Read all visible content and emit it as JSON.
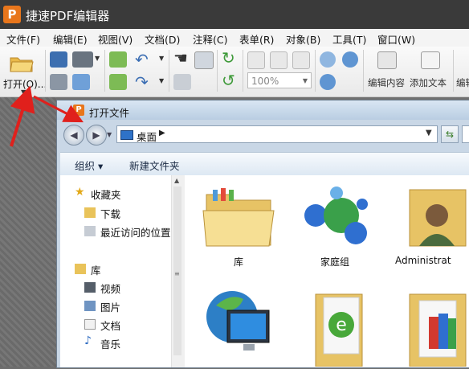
{
  "app": {
    "logo_letter": "P",
    "title": "捷速PDF编辑器"
  },
  "menu": [
    {
      "label": "文件(F)"
    },
    {
      "label": "编辑(E)"
    },
    {
      "label": "视图(V)"
    },
    {
      "label": "文档(D)"
    },
    {
      "label": "注释(C)"
    },
    {
      "label": "表单(R)"
    },
    {
      "label": "对象(B)"
    },
    {
      "label": "工具(T)"
    },
    {
      "label": "窗口(W)"
    }
  ],
  "toolbar": {
    "open_label": "打开(O)...",
    "zoom_value": "100%",
    "edit_content_label": "编辑内容",
    "add_text_label": "添加文本",
    "edit_cut_label": "编辑"
  },
  "dialog": {
    "logo_letter": "P",
    "title": "打开文件",
    "address": "桌面",
    "commands": {
      "organize": "组织 ▾",
      "new_folder": "新建文件夹"
    },
    "nav": [
      {
        "label": "收藏夹"
      },
      {
        "label": "下载"
      },
      {
        "label": "最近访问的位置"
      },
      {
        "label": "库"
      },
      {
        "label": "视频"
      },
      {
        "label": "图片"
      },
      {
        "label": "文档"
      },
      {
        "label": "音乐"
      }
    ],
    "files": [
      {
        "label": "库"
      },
      {
        "label": "家庭组"
      },
      {
        "label": "Administrat"
      },
      {
        "label": ""
      },
      {
        "label": ""
      },
      {
        "label": ""
      }
    ]
  },
  "colors": {
    "accent": "#e8761c",
    "annotation": "#e0201c"
  }
}
